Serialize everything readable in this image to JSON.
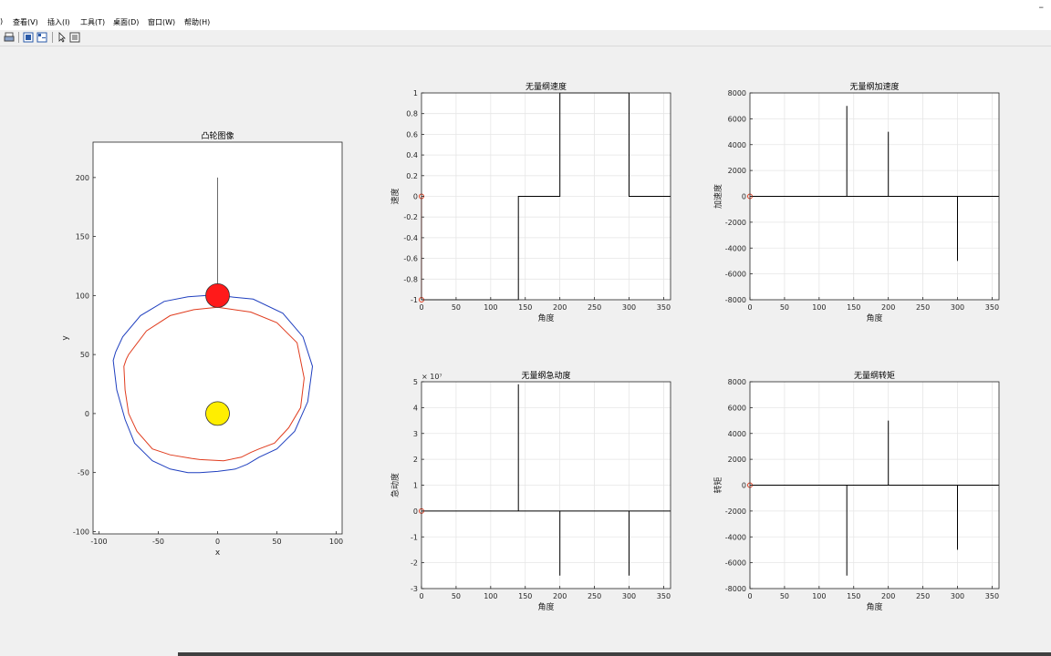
{
  "window": {
    "minimize_label": "–"
  },
  "menu": [
    {
      "label": ")"
    },
    {
      "label": "查看(V)"
    },
    {
      "label": "插入(I)"
    },
    {
      "label": "工具(T)"
    },
    {
      "label": "桌面(D)"
    },
    {
      "label": "窗口(W)"
    },
    {
      "label": "帮助(H)"
    }
  ],
  "toolbar": {
    "icons": [
      "print-icon",
      "link-plot-icon",
      "docked-figure-icon",
      "insert-legend-icon",
      "select-pointer-icon",
      "property-editor-icon"
    ]
  },
  "colors": {
    "blue_profile": "#1f3fbf",
    "red_profile": "#e03c1e",
    "follower": "#ff1a1a",
    "cam_center": "#ffee00"
  },
  "chart_data": [
    {
      "type": "line",
      "title": "凸轮图像",
      "xlabel": "x",
      "ylabel": "y",
      "xlim": [
        -105,
        105
      ],
      "ylim": [
        -102,
        230
      ],
      "xticks": [
        -100,
        -50,
        0,
        50,
        100
      ],
      "yticks": [
        -100,
        -50,
        0,
        50,
        100,
        150,
        200
      ],
      "series": [
        {
          "role": "actual-profile",
          "color": "#1f3fbf",
          "x": [
            0,
            30,
            55,
            72,
            80,
            76,
            65,
            50,
            35,
            25,
            15,
            0,
            -15,
            -25,
            -40,
            -55,
            -70,
            -78,
            -85,
            -88,
            -86,
            -80,
            -65,
            -45,
            -25,
            -10,
            0
          ],
          "y": [
            100,
            97,
            85,
            65,
            40,
            10,
            -15,
            -30,
            -37,
            -43,
            -47,
            -49,
            -50,
            -50,
            -47,
            -40,
            -25,
            -5,
            20,
            45,
            52,
            65,
            83,
            95,
            99,
            100,
            100
          ]
        },
        {
          "role": "theoretical-profile",
          "color": "#e03c1e",
          "x": [
            0,
            28,
            50,
            67,
            73,
            70,
            60,
            48,
            35,
            28,
            20,
            5,
            -15,
            -22,
            -40,
            -55,
            -68,
            -75,
            -78,
            -79,
            -77,
            -75,
            -60,
            -40,
            -20,
            0
          ],
          "y": [
            90,
            86,
            77,
            60,
            30,
            5,
            -12,
            -25,
            -30,
            -33,
            -37,
            -40,
            -39,
            -38,
            -35,
            -30,
            -15,
            0,
            20,
            40,
            46,
            50,
            70,
            83,
            88,
            90
          ]
        },
        {
          "role": "follower-rod",
          "color": "#444444",
          "x": [
            0,
            0
          ],
          "y": [
            100,
            200
          ]
        }
      ],
      "markers": [
        {
          "role": "follower-roller",
          "x": 0,
          "y": 100,
          "radius": 10,
          "color": "#ff1a1a"
        },
        {
          "role": "cam-center",
          "x": 0,
          "y": 0,
          "radius": 10,
          "color": "#ffee00"
        }
      ]
    },
    {
      "type": "line",
      "title": "无量纲速度",
      "xlabel": "角度",
      "ylabel": "速度",
      "xlim": [
        0,
        360
      ],
      "ylim": [
        -1,
        1
      ],
      "xticks": [
        0,
        50,
        100,
        150,
        200,
        250,
        300,
        350
      ],
      "yticks": [
        -1,
        -0.8,
        -0.6,
        -0.4,
        -0.2,
        0,
        0.2,
        0.4,
        0.6,
        0.8,
        1
      ],
      "ytick_labels": [
        "-1",
        "-0.8",
        "-0.6",
        "-0.4",
        "-0.2",
        "0",
        "0.2",
        "0.4",
        "0.6",
        "0.8",
        "1"
      ],
      "series": [
        {
          "color": "#000000",
          "x": [
            0,
            140,
            140,
            200,
            200,
            300,
            300,
            360
          ],
          "y": [
            -1,
            -1,
            0,
            0,
            1,
            1,
            0,
            0
          ]
        }
      ],
      "points": [
        {
          "x": 0,
          "y": 0,
          "color": "#e03c1e"
        },
        {
          "x": 0,
          "y": -1,
          "color": "#e03c1e"
        }
      ],
      "point_line": {
        "color": "#e03c1e",
        "x": [
          0,
          0
        ],
        "y": [
          0,
          -1
        ]
      }
    },
    {
      "type": "line",
      "title": "无量纲加速度",
      "xlabel": "角度",
      "ylabel": "加速度",
      "xlim": [
        0,
        360
      ],
      "ylim": [
        -8000,
        8000
      ],
      "xticks": [
        0,
        50,
        100,
        150,
        200,
        250,
        300,
        350
      ],
      "yticks": [
        -8000,
        -6000,
        -4000,
        -2000,
        0,
        2000,
        4000,
        6000,
        8000
      ],
      "ytick_labels": [
        "-8000",
        "-6000",
        "-4000",
        "-2000",
        "0",
        "2000",
        "4000",
        "6000",
        "8000"
      ],
      "series": [
        {
          "color": "#000000",
          "x": [
            0,
            140,
            140,
            140,
            200,
            200,
            200,
            300,
            300,
            300,
            360
          ],
          "y": [
            0,
            0,
            7000,
            0,
            0,
            5000,
            0,
            0,
            -5000,
            0,
            0
          ]
        }
      ],
      "points": [
        {
          "x": 0,
          "y": 0,
          "color": "#e03c1e"
        }
      ]
    },
    {
      "type": "line",
      "title": "无量纲急动度",
      "xlabel": "角度",
      "ylabel": "急动度",
      "xlim": [
        0,
        360
      ],
      "ylim": [
        -3,
        5
      ],
      "xticks": [
        0,
        50,
        100,
        150,
        200,
        250,
        300,
        350
      ],
      "yticks": [
        -3,
        -2,
        -1,
        0,
        1,
        2,
        3,
        4,
        5
      ],
      "ytick_labels": [
        "-3",
        "-2",
        "-1",
        "0",
        "1",
        "2",
        "3",
        "4",
        "5"
      ],
      "exponent_label": "× 10⁷",
      "series": [
        {
          "color": "#000000",
          "x": [
            0,
            140,
            140,
            140,
            200,
            200,
            200,
            300,
            300,
            300,
            360
          ],
          "y": [
            0,
            0,
            4.9,
            0,
            0,
            -2.5,
            0,
            0,
            -2.5,
            0,
            0
          ]
        }
      ],
      "points": [
        {
          "x": 0,
          "y": 0,
          "color": "#e03c1e"
        }
      ]
    },
    {
      "type": "line",
      "title": "无量纲转矩",
      "xlabel": "角度",
      "ylabel": "转矩",
      "xlim": [
        0,
        360
      ],
      "ylim": [
        -8000,
        8000
      ],
      "xticks": [
        0,
        50,
        100,
        150,
        200,
        250,
        300,
        350
      ],
      "yticks": [
        -8000,
        -6000,
        -4000,
        -2000,
        0,
        2000,
        4000,
        6000,
        8000
      ],
      "ytick_labels": [
        "-8000",
        "-6000",
        "-4000",
        "-2000",
        "0",
        "2000",
        "4000",
        "6000",
        "8000"
      ],
      "series": [
        {
          "color": "#000000",
          "x": [
            0,
            140,
            140,
            140,
            200,
            200,
            200,
            300,
            300,
            300,
            360
          ],
          "y": [
            0,
            0,
            -7000,
            0,
            0,
            5000,
            0,
            0,
            -5000,
            0,
            0
          ]
        }
      ],
      "points": [
        {
          "x": 0,
          "y": 0,
          "color": "#e03c1e"
        }
      ]
    }
  ]
}
